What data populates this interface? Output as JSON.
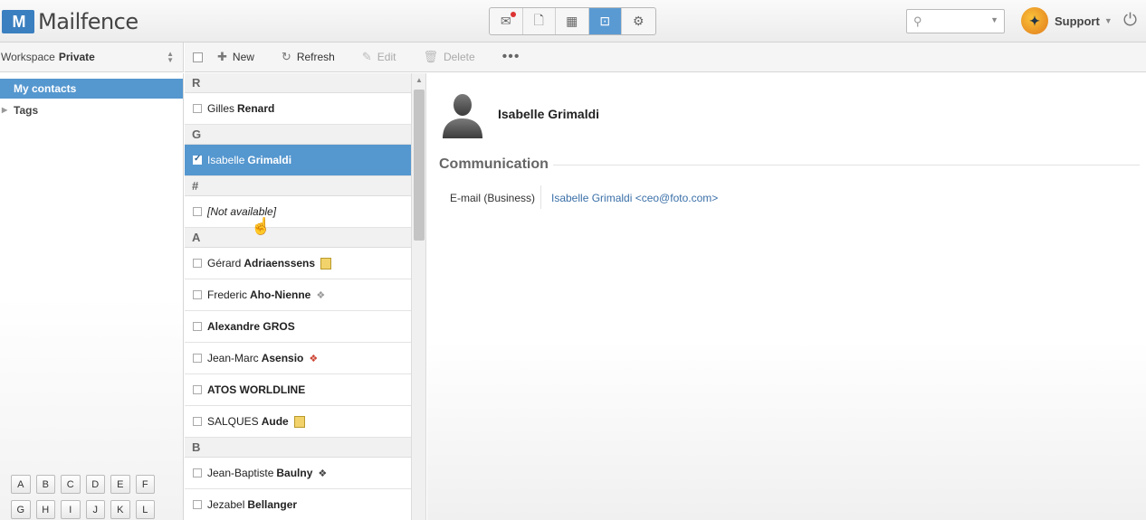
{
  "app": {
    "name": "Mailfence",
    "logo_mark": "M"
  },
  "header": {
    "apps": [
      {
        "name": "mail-app-icon",
        "glyph": "✉",
        "active": false,
        "badge": true
      },
      {
        "name": "documents-app-icon",
        "glyph": "🗋",
        "active": false,
        "badge": false
      },
      {
        "name": "calendar-app-icon",
        "glyph": "▦",
        "active": false,
        "badge": false
      },
      {
        "name": "contacts-app-icon",
        "glyph": "⊡",
        "active": true,
        "badge": false
      },
      {
        "name": "settings-app-icon",
        "glyph": "⚙",
        "active": false,
        "badge": false
      }
    ],
    "search": {
      "placeholder": "",
      "value": ""
    },
    "support": {
      "label": "Support"
    }
  },
  "workspace": {
    "label": "Workspace",
    "value": "Private"
  },
  "toolbar": {
    "new": "New",
    "refresh": "Refresh",
    "edit": "Edit",
    "delete": "Delete",
    "more": "•••"
  },
  "sidebar": {
    "my_contacts": "My contacts",
    "tags": "Tags",
    "alphabet_rows": [
      [
        "A",
        "B",
        "C",
        "D",
        "E",
        "F"
      ],
      [
        "G",
        "H",
        "I",
        "J",
        "K",
        "L"
      ]
    ]
  },
  "contacts": [
    {
      "type": "section",
      "label": "R"
    },
    {
      "type": "item",
      "first": "Gilles",
      "last": "Renard"
    },
    {
      "type": "section",
      "label": "G"
    },
    {
      "type": "item",
      "first": "Isabelle",
      "last": "Grimaldi",
      "selected": true
    },
    {
      "type": "section",
      "label": "#"
    },
    {
      "type": "item",
      "first": "[Not available]",
      "last": "",
      "italic": true
    },
    {
      "type": "section",
      "label": "A"
    },
    {
      "type": "item",
      "first": "Gérard",
      "last": "Adriaenssens",
      "badge": "note"
    },
    {
      "type": "item",
      "first": "Frederic",
      "last": "Aho-Nienne",
      "badge": "tag"
    },
    {
      "type": "item",
      "first": "",
      "last": "Alexandre GROS"
    },
    {
      "type": "item",
      "first": "Jean-Marc",
      "last": "Asensio",
      "badge": "tag2"
    },
    {
      "type": "item",
      "first": "",
      "last": "ATOS WORLDLINE"
    },
    {
      "type": "item",
      "first": "SALQUES",
      "last": "Aude",
      "badge": "note"
    },
    {
      "type": "section",
      "label": "B"
    },
    {
      "type": "item",
      "first": "Jean-Baptiste",
      "last": "Baulny",
      "badge": "tag3"
    },
    {
      "type": "item",
      "first": "Jezabel",
      "last": "Bellanger"
    }
  ],
  "detail": {
    "name": "Isabelle Grimaldi",
    "section": "Communication",
    "email_label": "E-mail (Business)",
    "email_value": "Isabelle Grimaldi <ceo@foto.com>"
  }
}
